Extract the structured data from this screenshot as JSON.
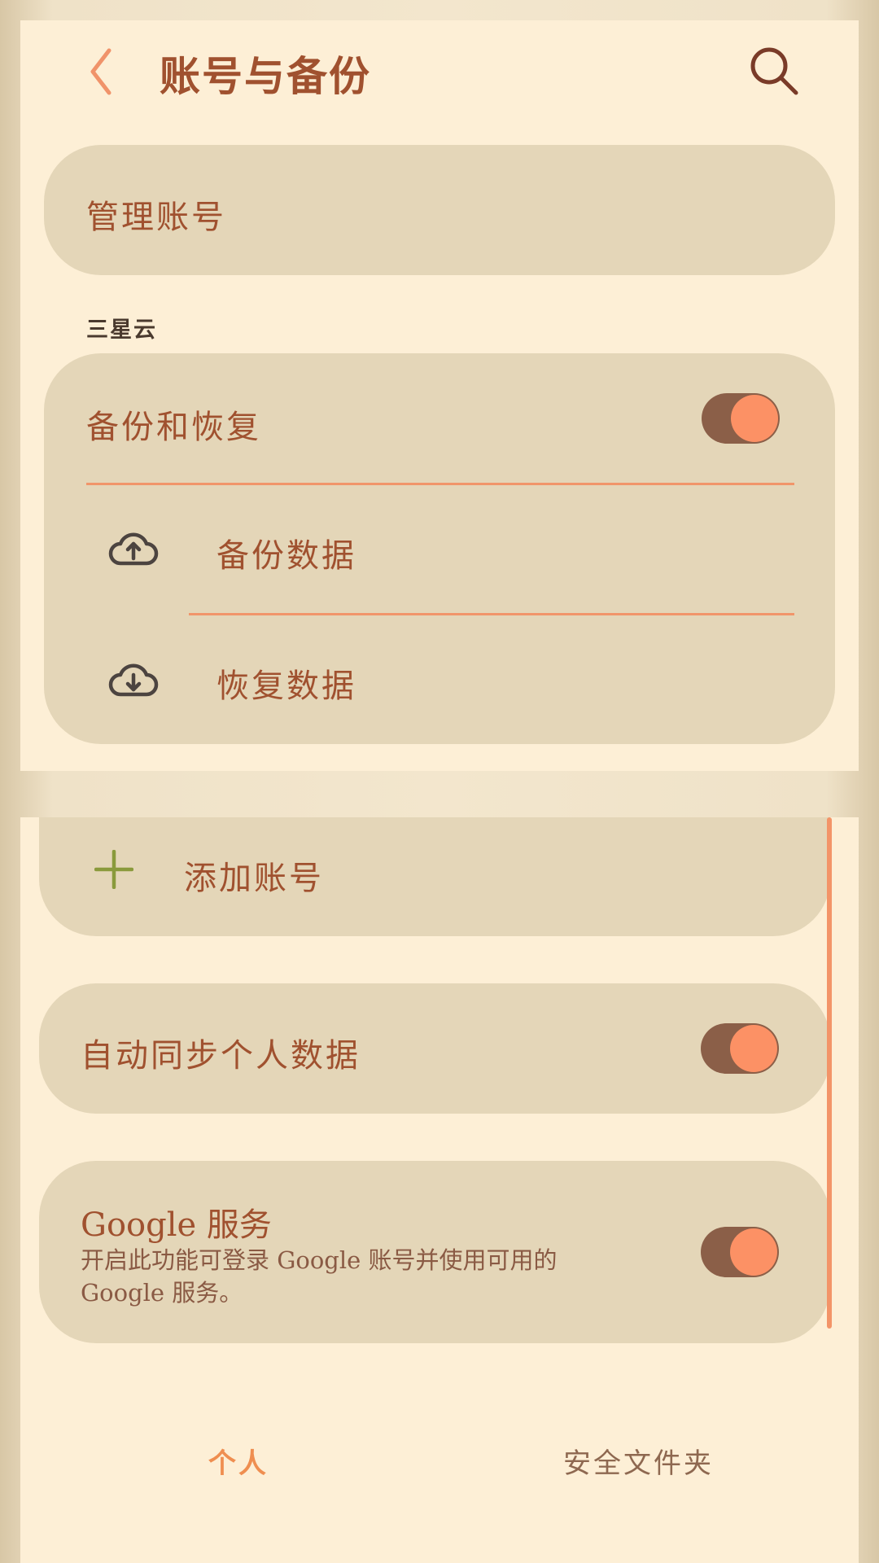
{
  "header": {
    "title": "账号与备份",
    "back_icon": "chevron-left-icon",
    "search_icon": "search-icon"
  },
  "manage_accounts": {
    "label": "管理账号"
  },
  "samsung_cloud": {
    "section_title": "三星云",
    "backup_restore": {
      "label": "备份和恢复",
      "enabled": true
    },
    "backup_data": {
      "label": "备份数据",
      "icon": "cloud-upload-icon"
    },
    "restore_data": {
      "label": "恢复数据",
      "icon": "cloud-download-icon"
    }
  },
  "add_account": {
    "label": "添加账号",
    "icon": "plus-icon"
  },
  "auto_sync": {
    "label": "自动同步个人数据",
    "enabled": true
  },
  "google_services": {
    "title": "Google 服务",
    "description": "开启此功能可登录 Google 账号并使用可用的 Google 服务。",
    "enabled": true
  },
  "bottom_tabs": [
    {
      "label": "个人",
      "selected": true
    },
    {
      "label": "安全文件夹",
      "selected": false
    }
  ],
  "colors": {
    "accent": "#fc9165",
    "title": "#a0512f",
    "card": "#e4d6b8",
    "panel": "#fdefd6",
    "toggle_track": "#8b5f48",
    "plus": "#8a9a3c"
  }
}
